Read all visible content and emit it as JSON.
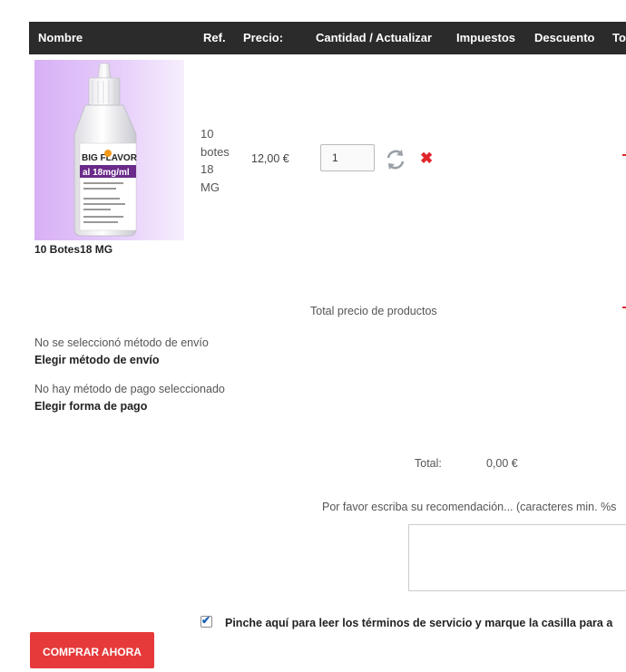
{
  "table": {
    "headers": [
      "Nombre",
      "Ref.",
      "Precio:",
      "Cantidad / Actualizar",
      "Impuestos",
      "Descuento",
      "To"
    ]
  },
  "product": {
    "name": "10 Botes18 MG",
    "ref_lines": [
      "10",
      "botes",
      "18",
      "MG"
    ],
    "price": "12,00 €",
    "quantity": "1",
    "image_label": {
      "brand": "BIG FLAVOR",
      "strength": "al 18mg/ml"
    }
  },
  "summary": {
    "total_products_label": "Total precio de productos",
    "shipping_message": "No se seleccionó método de envío",
    "shipping_link": "Elegir método de envío",
    "payment_message": "No hay método de pago seleccionado",
    "payment_link": "Elegir forma de pago",
    "total_label": "Total:",
    "total_value": "0,00 €"
  },
  "recommendation": {
    "label": "Por favor escriba su recomendación... (caracteres min. %s"
  },
  "terms": {
    "checked": true,
    "label": "Pinche aquí para leer los términos de servicio y marque la casilla para a"
  },
  "checkout": {
    "button_label": "COMPRAR AHORA"
  },
  "colors": {
    "header_bg": "#2b2b2b",
    "accent_red": "#e63a3a",
    "thumb_bg": "#d7b0f5"
  }
}
